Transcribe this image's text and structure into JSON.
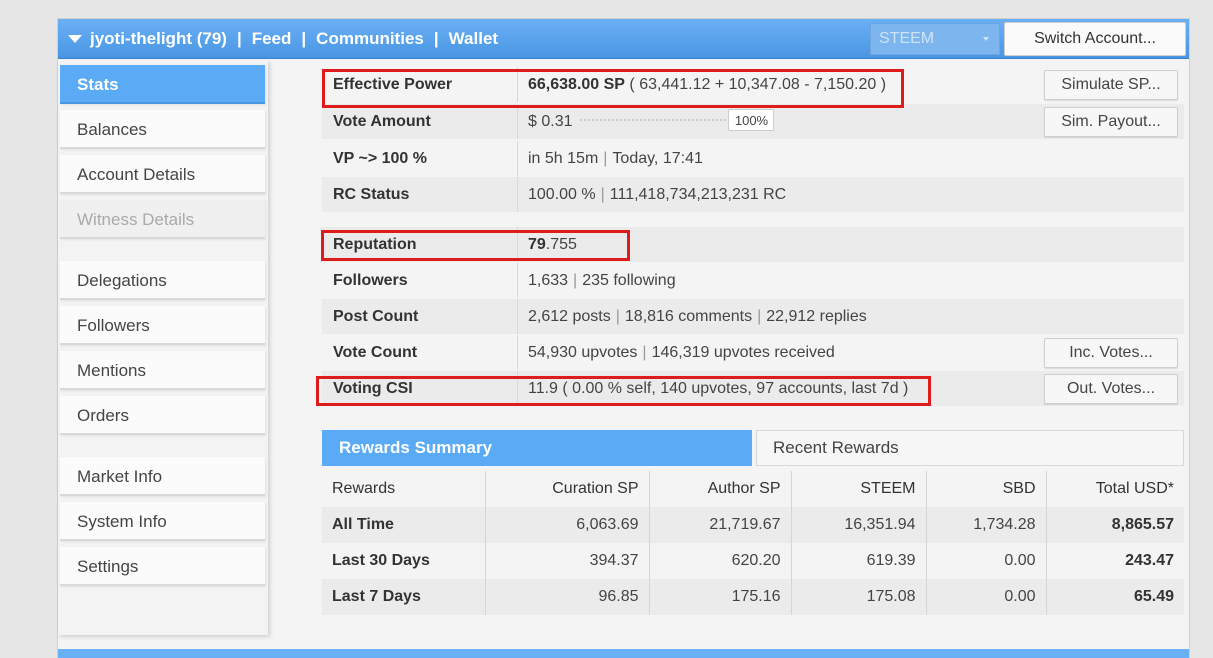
{
  "header": {
    "account": "jyoti-thelight (79)",
    "nav": [
      "Feed",
      "Communities",
      "Wallet"
    ],
    "separator": "|",
    "chain_select": "STEEM",
    "switch_account": "Switch Account..."
  },
  "sidebar": {
    "items": [
      {
        "label": "Stats",
        "state": "active"
      },
      {
        "label": "Balances",
        "state": "normal"
      },
      {
        "label": "Account Details",
        "state": "normal"
      },
      {
        "label": "Witness Details",
        "state": "disabled"
      },
      {
        "label": "Delegations",
        "state": "normal"
      },
      {
        "label": "Followers",
        "state": "normal"
      },
      {
        "label": "Mentions",
        "state": "normal"
      },
      {
        "label": "Orders",
        "state": "normal"
      },
      {
        "label": "Market Info",
        "state": "normal"
      },
      {
        "label": "System Info",
        "state": "normal"
      },
      {
        "label": "Settings",
        "state": "normal"
      }
    ]
  },
  "stats": {
    "effective_power": {
      "label": "Effective Power",
      "value_bold": "66,638.00 SP",
      "value_rest": "( 63,441.12 + 10,347.08 - 7,150.20 )",
      "button": "Simulate SP..."
    },
    "vote_amount": {
      "label": "Vote Amount",
      "value": "$ 0.31",
      "slider_pct": "100%",
      "button": "Sim. Payout..."
    },
    "vp": {
      "label": "VP ~> 100 %",
      "value1": "in 5h 15m",
      "value2": "Today, 17:41"
    },
    "rc": {
      "label": "RC Status",
      "value1": "100.00 %",
      "value2": "111,418,734,213,231 RC"
    },
    "reputation": {
      "label": "Reputation",
      "value_bold": "79",
      "value_rest": ".755"
    },
    "followers": {
      "label": "Followers",
      "value1": "1,633",
      "value2": "235 following"
    },
    "post_count": {
      "label": "Post Count",
      "value1": "2,612 posts",
      "value2": "18,816 comments",
      "value3": "22,912 replies"
    },
    "vote_count": {
      "label": "Vote Count",
      "value1": "54,930 upvotes",
      "value2": "146,319 upvotes received",
      "button": "Inc. Votes..."
    },
    "voting_csi": {
      "label": "Voting CSI",
      "value": "11.9 ( 0.00 % self, 140 upvotes, 97 accounts, last 7d )",
      "button": "Out. Votes..."
    }
  },
  "tabs": {
    "summary": "Rewards Summary",
    "recent": "Recent Rewards"
  },
  "rewards_table": {
    "headers": [
      "Rewards",
      "Curation SP",
      "Author SP",
      "STEEM",
      "SBD",
      "Total USD*"
    ],
    "rows": [
      [
        "All Time",
        "6,063.69",
        "21,719.67",
        "16,351.94",
        "1,734.28",
        "8,865.57"
      ],
      [
        "Last 30 Days",
        "394.37",
        "620.20",
        "619.39",
        "0.00",
        "243.47"
      ],
      [
        "Last 7 Days",
        "96.85",
        "175.16",
        "175.08",
        "0.00",
        "65.49"
      ]
    ]
  },
  "colors": {
    "accent": "#5aaaf5",
    "highlight": "#e01b1b"
  }
}
